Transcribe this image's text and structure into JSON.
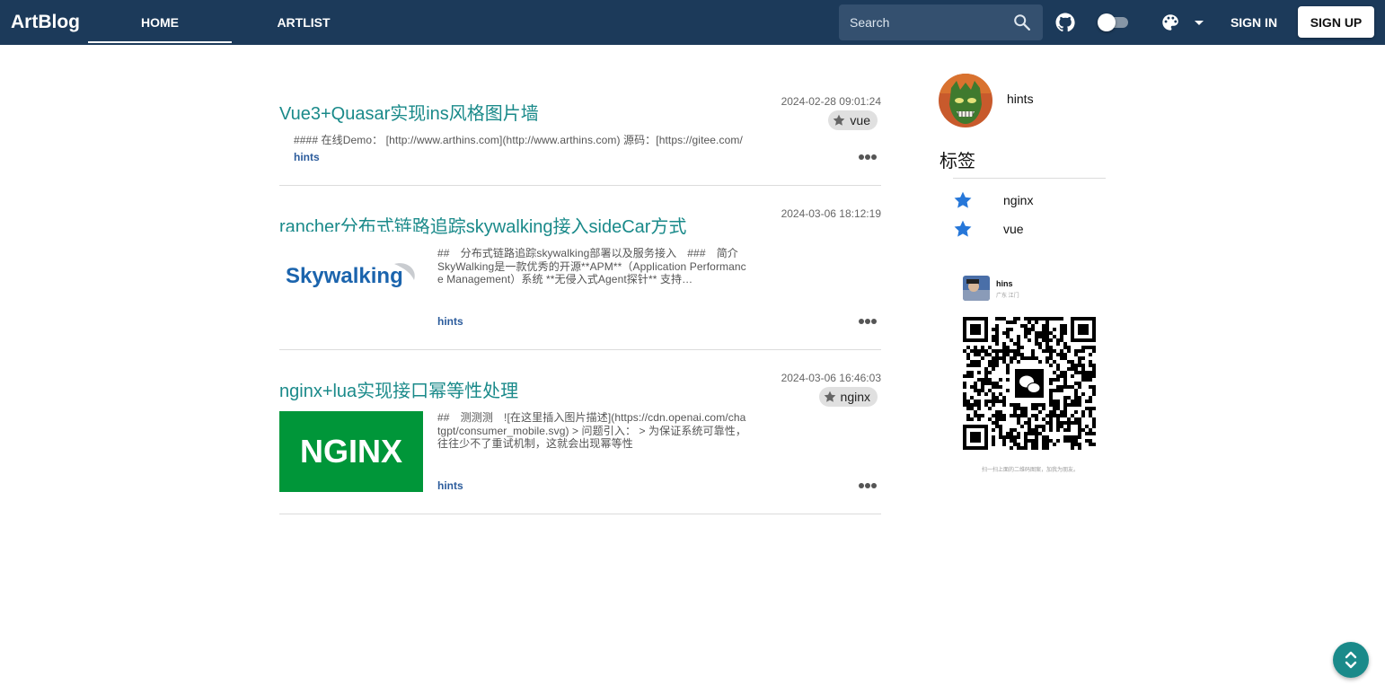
{
  "header": {
    "brand": "ArtBlog",
    "tabs": [
      {
        "label": "HOME",
        "active": true
      },
      {
        "label": "ARTLIST",
        "active": false
      }
    ],
    "search_placeholder": "Search",
    "signin_label": "SIGN IN",
    "signup_label": "SIGN UP",
    "colors": {
      "bar": "#1c3a5a",
      "accent": "#1a8a8a"
    }
  },
  "articles": [
    {
      "title": "Vue3+Quasar实现ins风格图片墙",
      "date": "2024-02-28 09:01:24",
      "tag": "vue",
      "excerpt": "#### 在线Demo： [http://www.arthins.com](http://www.arthins.com) 源码：[https://gitee.com/",
      "author": "hints"
    },
    {
      "title": "rancher分布式链路追踪skywalking接入sideCar方式",
      "date": "2024-03-06 18:12:19",
      "thumbnail_text": "Skywalking",
      "excerpt": "##　分布式链路追踪skywalking部署以及服务接入　###　简介 SkyWalking是一款优秀的开源**APM**（Application Performance Management）系统 **无侵入式Agent探针** 支持…",
      "author": "hints"
    },
    {
      "title": "nginx+lua实现接口幂等性处理",
      "date": "2024-03-06 16:46:03",
      "tag": "nginx",
      "thumbnail_text": "NGINX",
      "excerpt": "##　测测测　![在这里插入图片描述](https://cdn.openai.com/chatgpt/consumer_mobile.svg) > 问题引入： > 为保证系统可靠性，往往少不了重试机制，这就会出现幂等性",
      "author": "hints"
    }
  ],
  "sidebar": {
    "user_name": "hints",
    "tags_heading": "标签",
    "tags": [
      {
        "label": "nginx"
      },
      {
        "label": "vue"
      }
    ],
    "qr_card": {
      "name": "hins",
      "location": "广东 江门",
      "caption": "扫一扫上面的二维码图案，加我为朋友。"
    }
  }
}
